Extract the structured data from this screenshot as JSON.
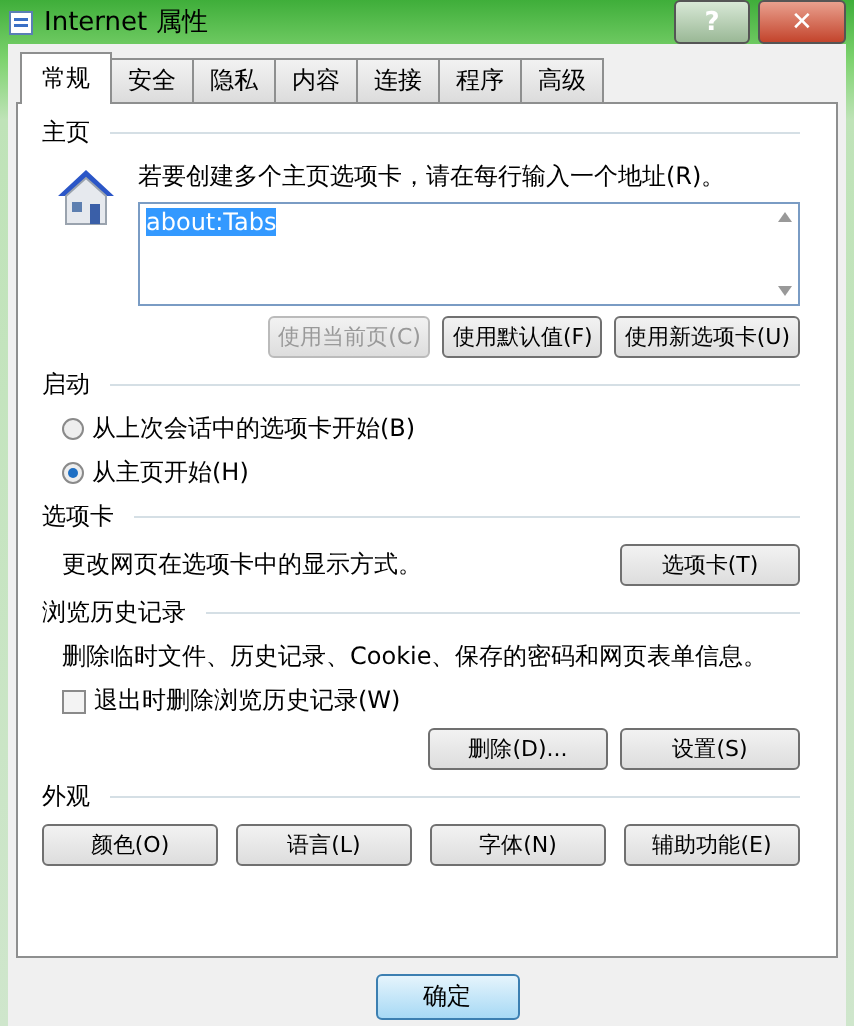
{
  "window": {
    "title": "Internet 属性",
    "help_button": "?",
    "close_button": "✕"
  },
  "tabs": [
    {
      "label": "常规",
      "selected": true
    },
    {
      "label": "安全",
      "selected": false
    },
    {
      "label": "隐私",
      "selected": false
    },
    {
      "label": "内容",
      "selected": false
    },
    {
      "label": "连接",
      "selected": false
    },
    {
      "label": "程序",
      "selected": false
    },
    {
      "label": "高级",
      "selected": false
    }
  ],
  "homepage": {
    "heading": "主页",
    "instruction": "若要创建多个主页选项卡，请在每行输入一个地址(R)。",
    "value": "about:Tabs",
    "buttons": [
      {
        "label": "使用当前页(C)",
        "disabled": true
      },
      {
        "label": "使用默认值(F)",
        "disabled": false
      },
      {
        "label": "使用新选项卡(U)",
        "disabled": false
      }
    ]
  },
  "startup": {
    "heading": "启动",
    "options": [
      {
        "label": "从上次会话中的选项卡开始(B)",
        "selected": false
      },
      {
        "label": "从主页开始(H)",
        "selected": true
      }
    ]
  },
  "tabs_section": {
    "heading": "选项卡",
    "description": "更改网页在选项卡中的显示方式。",
    "button": "选项卡(T)"
  },
  "history": {
    "heading": "浏览历史记录",
    "description": "删除临时文件、历史记录、Cookie、保存的密码和网页表单信息。",
    "checkbox": {
      "label": "退出时删除浏览历史记录(W)",
      "checked": false
    },
    "buttons": [
      "删除(D)...",
      "设置(S)"
    ]
  },
  "appearance": {
    "heading": "外观",
    "buttons": [
      "颜色(O)",
      "语言(L)",
      "字体(N)",
      "辅助功能(E)"
    ]
  },
  "footer_buttons": [
    "确定"
  ]
}
